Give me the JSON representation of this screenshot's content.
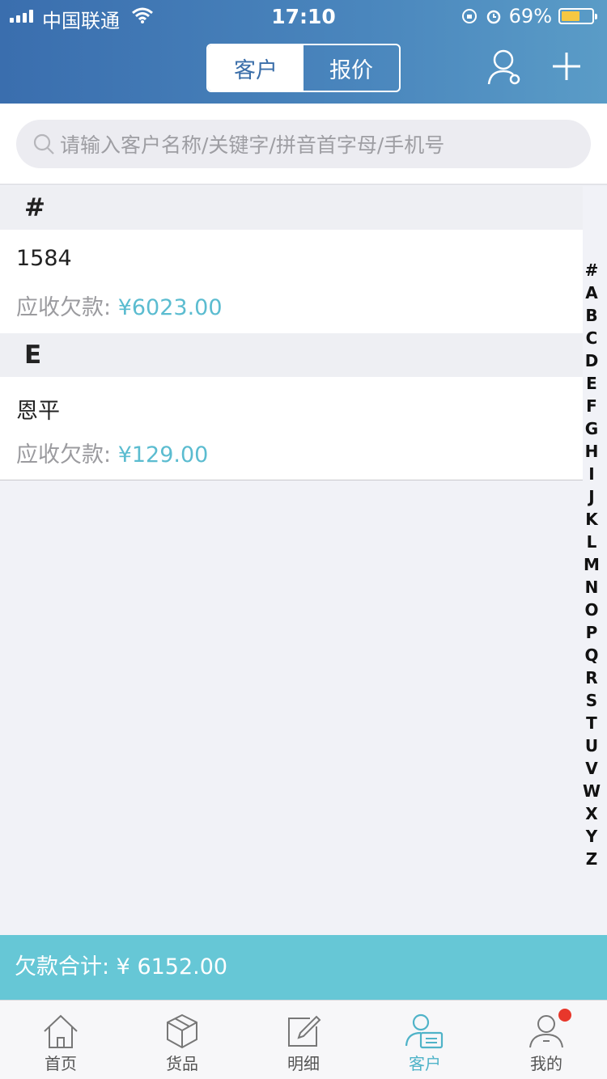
{
  "status_bar": {
    "carrier": "中国联通",
    "time": "17:10",
    "battery": "69%"
  },
  "header": {
    "tabs": [
      "客户",
      "报价"
    ],
    "active_tab": "客户"
  },
  "search": {
    "placeholder": "请输入客户名称/关键字/拼音首字母/手机号"
  },
  "sections": [
    {
      "letter": "#",
      "customers": [
        {
          "name": "1584",
          "debt_label": "应收欠款:",
          "debt_amount": "¥6023.00"
        }
      ]
    },
    {
      "letter": "E",
      "customers": [
        {
          "name": "恩平",
          "debt_label": "应收欠款:",
          "debt_amount": "¥129.00"
        }
      ]
    }
  ],
  "index_letters": [
    "#",
    "A",
    "B",
    "C",
    "D",
    "E",
    "F",
    "G",
    "H",
    "I",
    "J",
    "K",
    "L",
    "M",
    "N",
    "O",
    "P",
    "Q",
    "R",
    "S",
    "T",
    "U",
    "V",
    "W",
    "X",
    "Y",
    "Z"
  ],
  "footer": {
    "total_text": "欠款合计: ¥ 6152.00"
  },
  "tabbar": {
    "items": [
      {
        "label": "首页",
        "icon": "home-icon"
      },
      {
        "label": "货品",
        "icon": "box-icon"
      },
      {
        "label": "明细",
        "icon": "edit-icon"
      },
      {
        "label": "客户",
        "icon": "customer-icon",
        "active": true
      },
      {
        "label": "我的",
        "icon": "profile-icon",
        "badge": true
      }
    ]
  },
  "colors": {
    "header": "#4a86bd",
    "accent": "#5bbcd0",
    "total_bar": "#66c7d6",
    "badge": "#e8372b"
  }
}
